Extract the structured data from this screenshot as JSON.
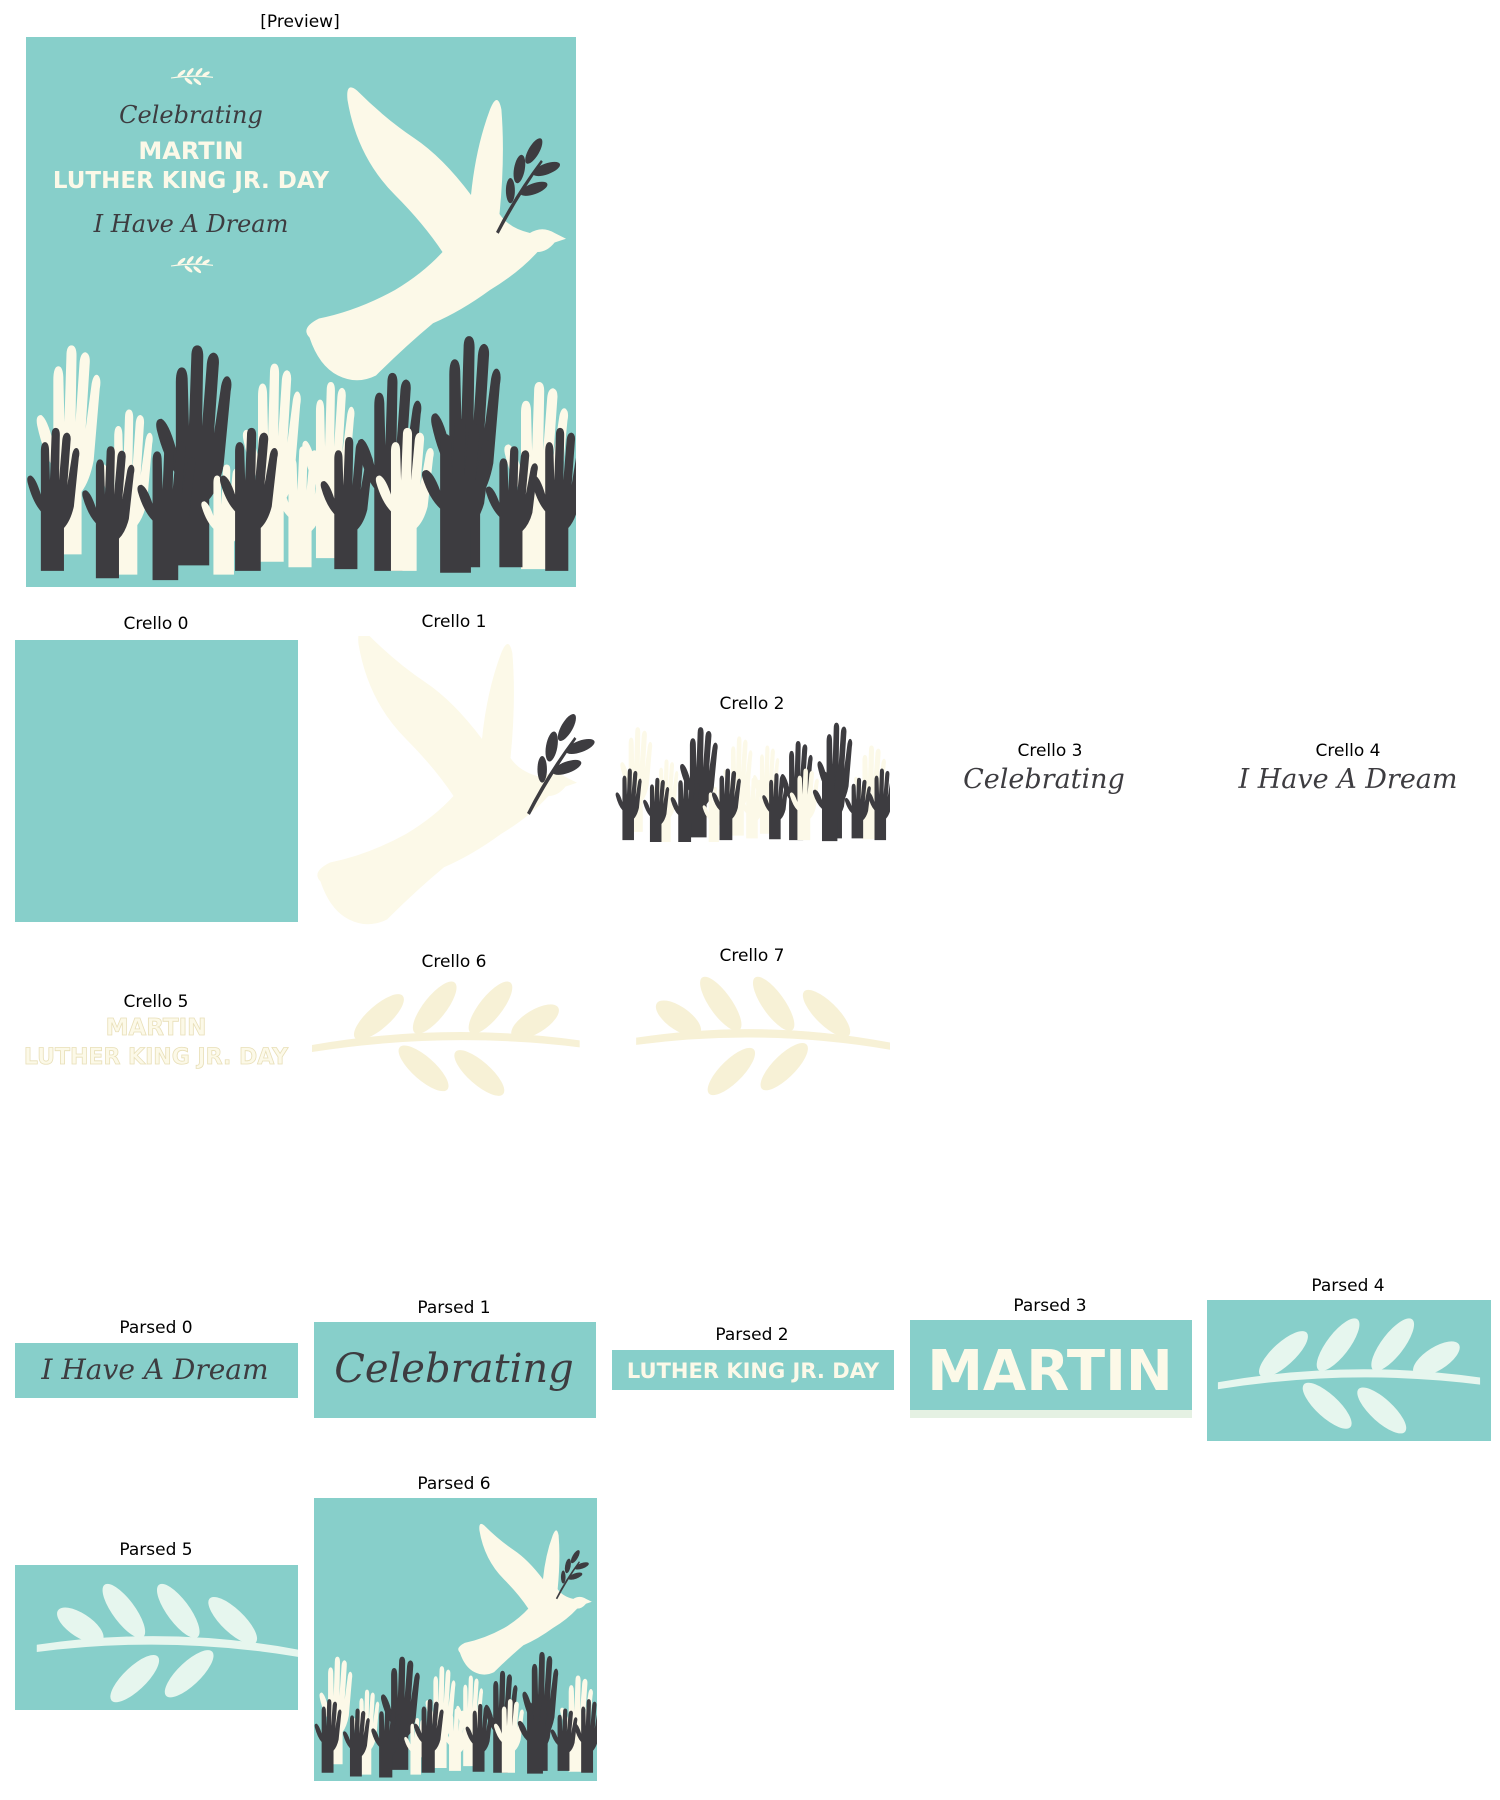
{
  "preview": {
    "label": "[Preview]",
    "text_celebrating": "Celebrating",
    "text_title_line1": "MARTIN",
    "text_title_line2": "LUTHER KING JR. DAY",
    "text_dream": "I Have A Dream"
  },
  "crello": {
    "c0": "Crello 0",
    "c1": "Crello 1",
    "c2": "Crello 2",
    "c3": "Crello 3",
    "c4": "Crello 4",
    "c5": "Crello 5",
    "c6": "Crello 6",
    "c7": "Crello 7",
    "text_celebrating": "Celebrating",
    "text_dream": "I Have A Dream",
    "text_title_line1": "MARTIN",
    "text_title_line2": "LUTHER KING JR. DAY"
  },
  "parsed": {
    "p0": "Parsed 0",
    "p1": "Parsed 1",
    "p2": "Parsed 2",
    "p3": "Parsed 3",
    "p4": "Parsed 4",
    "p5": "Parsed 5",
    "p6": "Parsed 6",
    "text_dream": "I Have A Dream",
    "text_celebrating": "Celebrating",
    "text_lkjd": "LUTHER KING JR. DAY",
    "text_martin": "MARTIN"
  },
  "colors": {
    "teal": "#87cfca",
    "cream": "#fcf9e8",
    "dark": "#3d3c40"
  }
}
